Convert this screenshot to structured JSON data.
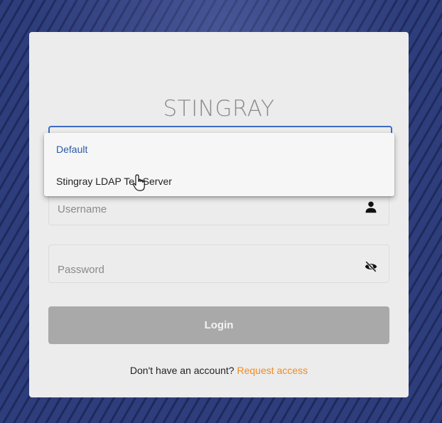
{
  "brand": {
    "title": "STINGRAY"
  },
  "login_provider": {
    "options": [
      "Default",
      "Stingray LDAP Test Server"
    ],
    "selected": "Default",
    "visible_second_option": "Stingray LDAP Te   Server"
  },
  "username": {
    "placeholder": "Username",
    "icon": "person-icon"
  },
  "password": {
    "placeholder": "Password",
    "icon": "eye-off-icon"
  },
  "login_button": {
    "label": "Login"
  },
  "footer": {
    "text": "Don't have an account?",
    "link": "Request access"
  },
  "colors": {
    "accent": "#3b6cc4",
    "link": "#f08a24",
    "button_disabled": "#a9a9a9",
    "background": "#27356e"
  }
}
